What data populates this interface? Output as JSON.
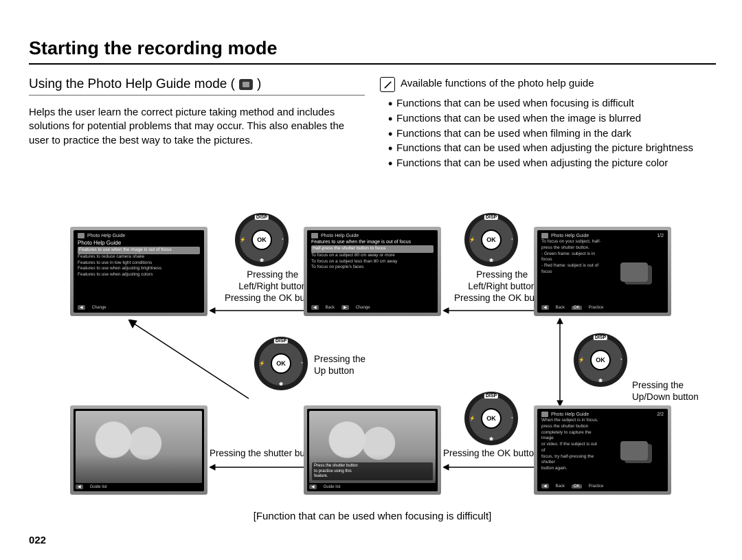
{
  "page_number": "022",
  "main_title": "Starting the recording mode",
  "section": {
    "heading_prefix": "Using the Photo Help Guide mode (",
    "heading_suffix": ")",
    "body": "Helps the user learn the correct picture taking method and includes solutions for potential problems that may occur. This also enables the user to practice the best way to take the pictures."
  },
  "note": {
    "title": "Available functions of the photo help guide",
    "bullets": [
      "Functions that can be used when focusing is difficult",
      "Functions that can be used when the image is blurred",
      "Functions that can be used when filming in the dark",
      "Functions that can be used when adjusting the picture brightness",
      "Functions that can be used when adjusting the picture color"
    ]
  },
  "dial": {
    "top": "DISP",
    "ok": "OK",
    "left_glyph": "⚡",
    "right_glyph": "◔",
    "bottom_glyph": "❀"
  },
  "captions": {
    "left_right_ok": "Pressing the\nLeft/Right button\nPressing the OK button",
    "left_right_ok_l1": "Pressing the",
    "left_right_ok_l2": "Left/Right button",
    "left_right_ok_l3": "Pressing the OK button",
    "up": "Pressing the\nUp button",
    "up_l1": "Pressing the",
    "up_l2": "Up button",
    "updown_l1": "Pressing the",
    "updown_l2": "Up/Down button",
    "shutter": "Pressing the shutter button",
    "ok": "Pressing the OK button",
    "flow_title": "[Function that can be used when focusing is difficult]"
  },
  "lcd": {
    "title": "Photo Help Guide",
    "a": {
      "sub": "Photo Help Guide",
      "items": [
        "Features to use when the image is out of focus",
        "Features to reduce camera shake",
        "Features to use in low light conditions",
        "Features to use when adjusting brightness",
        "Features to use when adjusting colors"
      ],
      "footer_left": "◀",
      "footer_label": "Change"
    },
    "b": {
      "sub": "Features to use when the image is out of focus",
      "items": [
        "Half-press the shutter button to focus",
        "To focus on a subject 80 cm away or more",
        "To focus on a subject less than 80 cm away",
        "To focus on people's faces"
      ],
      "footer_back": "Back",
      "footer_change": "Change"
    },
    "c": {
      "page": "1/2",
      "lines": [
        "To focus on your subject, half-",
        "press the shutter button.",
        "- Green frame: subject is in focus",
        "- Red frame: subject is out of focus"
      ],
      "footer_back": "Back",
      "footer_practice": "Practice"
    },
    "d": {
      "page": "2/2",
      "lines": [
        "When the subject is in focus,",
        "press the shutter button",
        "completely to capture the image",
        "or video. If the subject is out of",
        "focus, try half-pressing the shutter",
        "button again."
      ],
      "footer_back": "Back",
      "footer_practice": "Practice"
    },
    "practice_overlay": "Press the shutter button\nto practice using this\nfeature.",
    "practice_overlay_l1": "Press the shutter button",
    "practice_overlay_l2": "to practice using this",
    "practice_overlay_l3": "feature.",
    "guide_list": "Guide list",
    "ok_tag": "OK"
  }
}
